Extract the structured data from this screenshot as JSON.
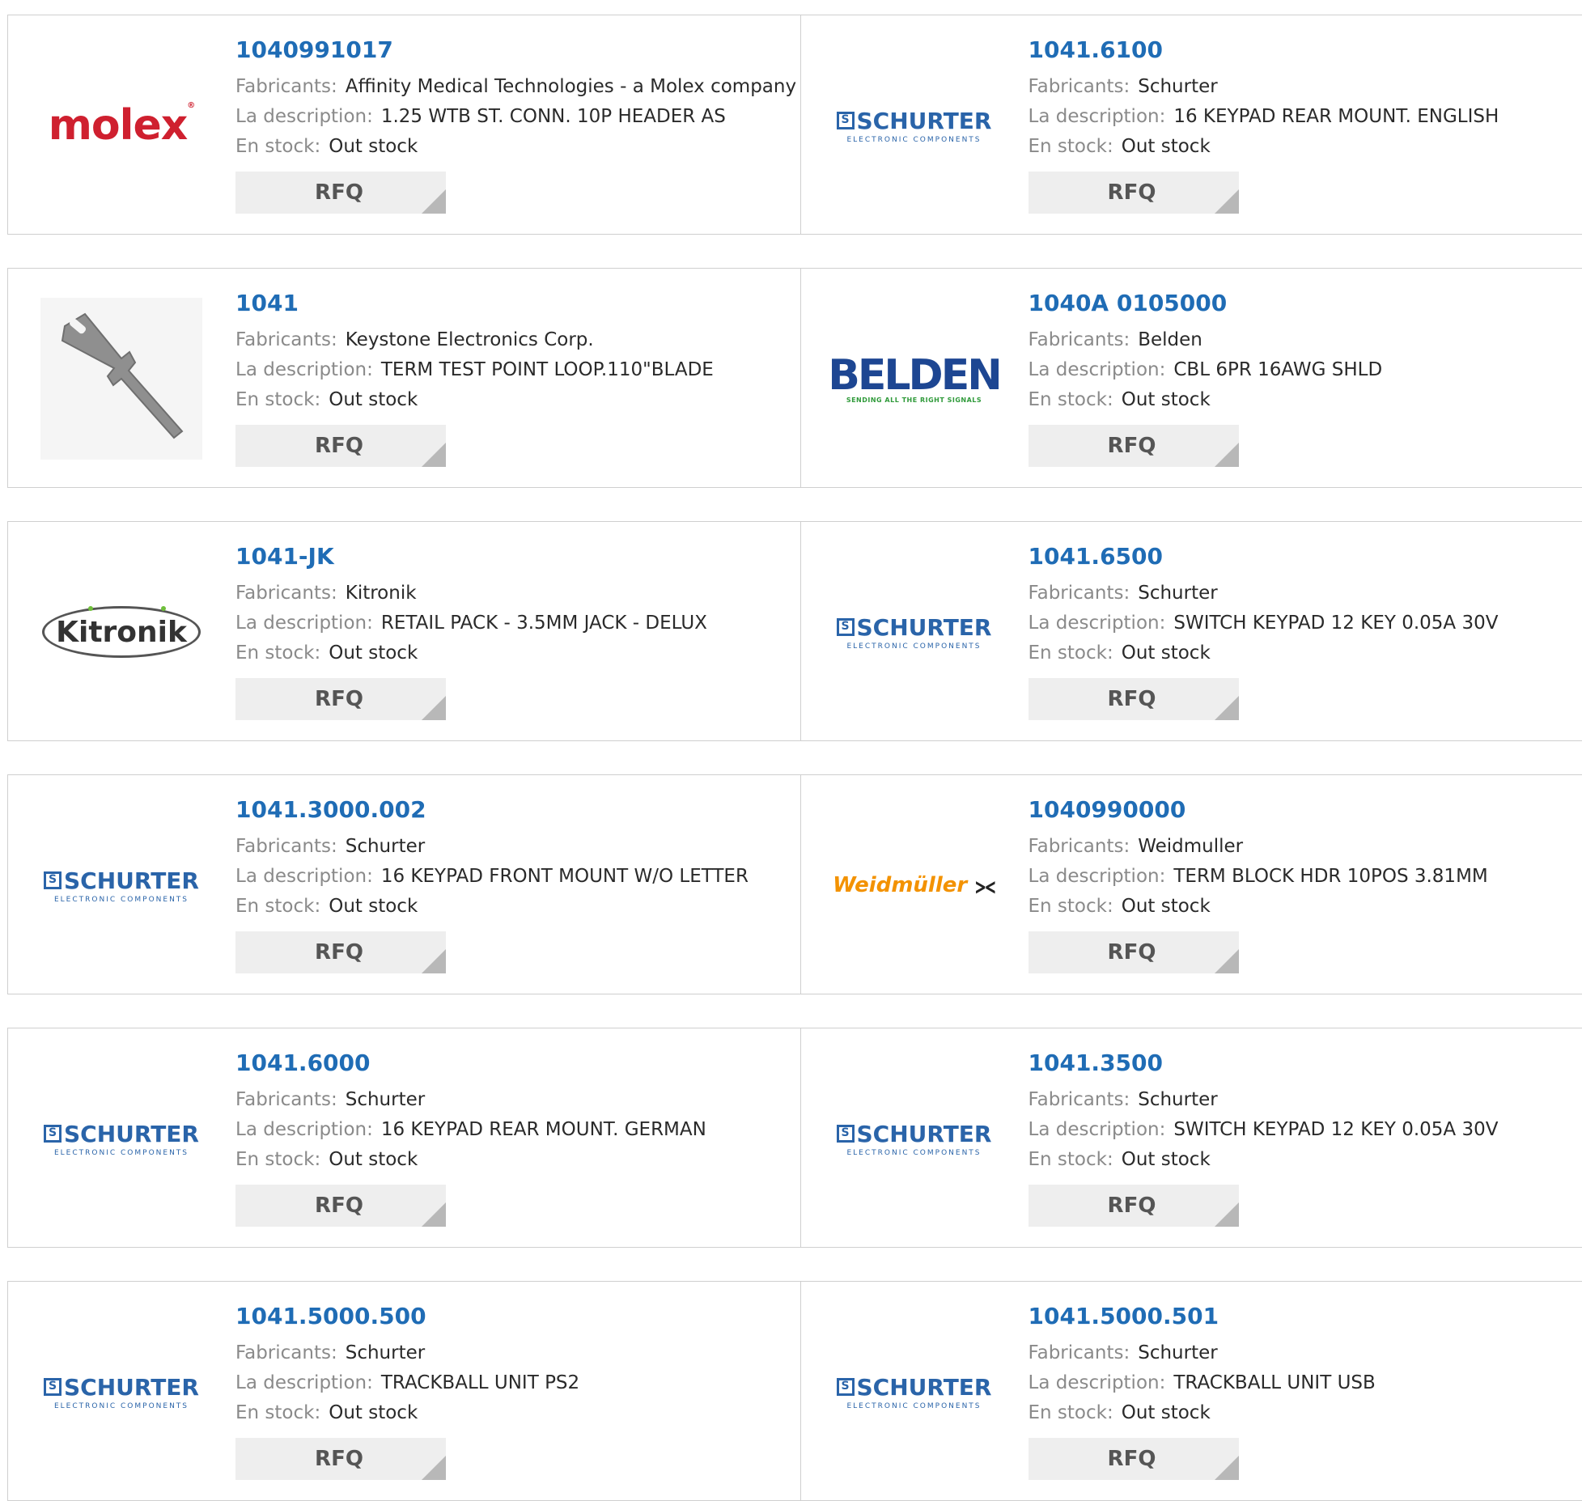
{
  "labels": {
    "manufacturer": "Fabricants:",
    "description": "La description:",
    "stock": "En stock:",
    "rfq": "RFQ"
  },
  "rows": [
    [
      {
        "part": "1040991017",
        "manufacturer": "Affinity Medical Technologies - a Molex company",
        "description": "1.25 WTB ST. CONN. 10P HEADER AS",
        "stock": "Out stock",
        "logo": "molex",
        "logo_text": "molex"
      },
      {
        "part": "1041.6100",
        "manufacturer": "Schurter",
        "description": "16 KEYPAD REAR MOUNT. ENGLISH",
        "stock": "Out stock",
        "logo": "schurter",
        "logo_text": "SCHURTER",
        "logo_sub": "ELECTRONIC COMPONENTS"
      }
    ],
    [
      {
        "part": "1041",
        "manufacturer": "Keystone Electronics Corp.",
        "description": "TERM TEST POINT LOOP.110\"BLADE",
        "stock": "Out stock",
        "logo": "blade-photo"
      },
      {
        "part": "1040A 0105000",
        "manufacturer": "Belden",
        "description": "CBL 6PR 16AWG SHLD",
        "stock": "Out stock",
        "logo": "belden",
        "logo_text": "BELDEN",
        "logo_sub": "SENDING ALL THE RIGHT SIGNALS"
      }
    ],
    [
      {
        "part": "1041-JK",
        "manufacturer": "Kitronik",
        "description": "RETAIL PACK - 3.5MM JACK - DELUX",
        "stock": "Out stock",
        "logo": "kitronik",
        "logo_text": "Kitronik"
      },
      {
        "part": "1041.6500",
        "manufacturer": "Schurter",
        "description": "SWITCH KEYPAD 12 KEY 0.05A 30V",
        "stock": "Out stock",
        "logo": "schurter",
        "logo_text": "SCHURTER",
        "logo_sub": "ELECTRONIC COMPONENTS"
      }
    ],
    [
      {
        "part": "1041.3000.002",
        "manufacturer": "Schurter",
        "description": "16 KEYPAD FRONT MOUNT W/O LETTER",
        "stock": "Out stock",
        "logo": "schurter",
        "logo_text": "SCHURTER",
        "logo_sub": "ELECTRONIC COMPONENTS"
      },
      {
        "part": "1040990000",
        "manufacturer": "Weidmuller",
        "description": "TERM BLOCK HDR 10POS 3.81MM",
        "stock": "Out stock",
        "logo": "weidmuller",
        "logo_text": "Weidmüller"
      }
    ],
    [
      {
        "part": "1041.6000",
        "manufacturer": "Schurter",
        "description": "16 KEYPAD REAR MOUNT. GERMAN",
        "stock": "Out stock",
        "logo": "schurter",
        "logo_text": "SCHURTER",
        "logo_sub": "ELECTRONIC COMPONENTS"
      },
      {
        "part": "1041.3500",
        "manufacturer": "Schurter",
        "description": "SWITCH KEYPAD 12 KEY 0.05A 30V",
        "stock": "Out stock",
        "logo": "schurter",
        "logo_text": "SCHURTER",
        "logo_sub": "ELECTRONIC COMPONENTS"
      }
    ],
    [
      {
        "part": "1041.5000.500",
        "manufacturer": "Schurter",
        "description": "TRACKBALL UNIT PS2",
        "stock": "Out stock",
        "logo": "schurter",
        "logo_text": "SCHURTER",
        "logo_sub": "ELECTRONIC COMPONENTS"
      },
      {
        "part": "1041.5000.501",
        "manufacturer": "Schurter",
        "description": "TRACKBALL UNIT USB",
        "stock": "Out stock",
        "logo": "schurter",
        "logo_text": "SCHURTER",
        "logo_sub": "ELECTRONIC COMPONENTS"
      }
    ]
  ]
}
